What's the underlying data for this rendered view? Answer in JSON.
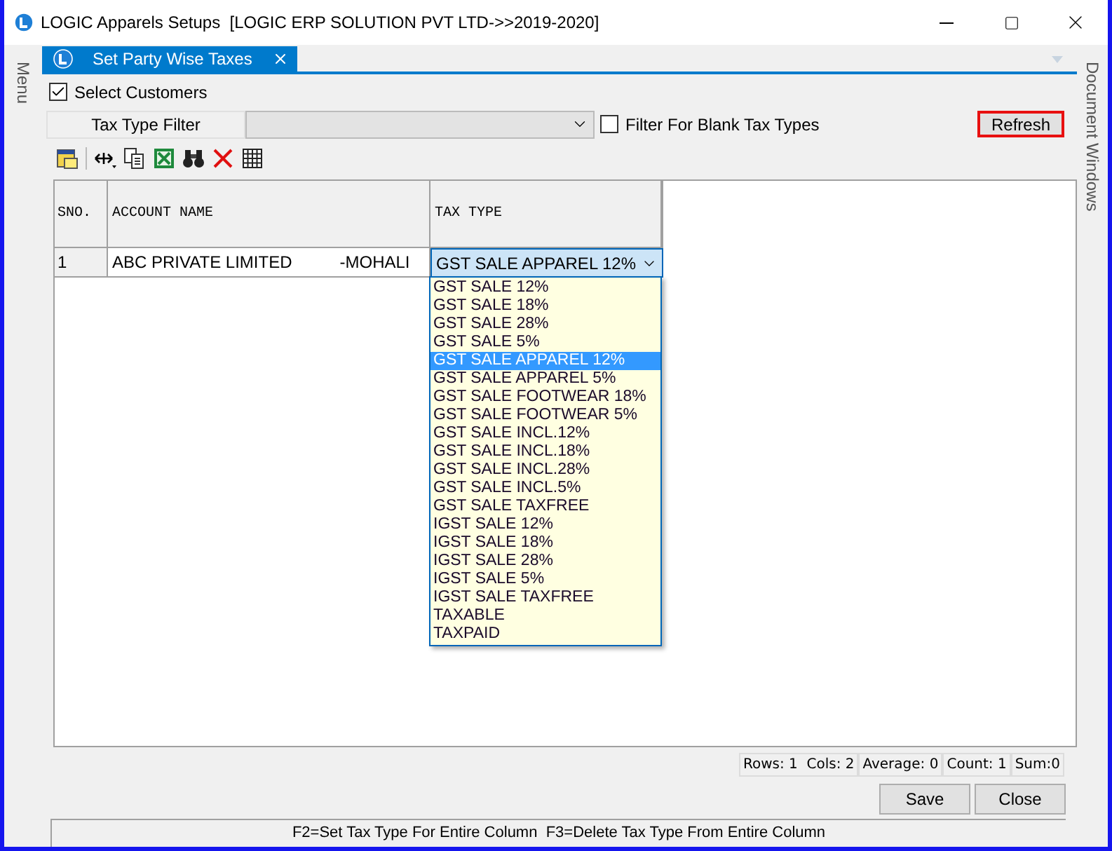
{
  "window": {
    "title": "LOGIC Apparels Setups  [LOGIC ERP SOLUTION PVT LTD->>2019-2020]"
  },
  "side_panels": {
    "left": "Menu",
    "right": "Document Windows"
  },
  "tabs": [
    {
      "label": "Set Party Wise Taxes",
      "selected": true
    }
  ],
  "select_customers": {
    "label": "Select Customers",
    "checked": true
  },
  "filter": {
    "label": "Tax Type Filter",
    "blank_filter": {
      "label": "Filter For Blank Tax Types",
      "checked": false
    }
  },
  "refresh_button": "Refresh",
  "table": {
    "columns": [
      "SNO.",
      "ACCOUNT NAME",
      "TAX TYPE"
    ],
    "rows": [
      {
        "sno": "1",
        "account_name": "ABC PRIVATE LIMITED",
        "location": "-MOHALI",
        "tax_type": "GST SALE APPAREL 12%"
      }
    ]
  },
  "dropdown": {
    "options": [
      {
        "label": "GST SALE 12%",
        "selected": false
      },
      {
        "label": "GST SALE 18%",
        "selected": false
      },
      {
        "label": "GST SALE 28%",
        "selected": false
      },
      {
        "label": "GST SALE 5%",
        "selected": false
      },
      {
        "label": "GST SALE APPAREL 12%",
        "selected": true
      },
      {
        "label": "GST SALE APPAREL 5%",
        "selected": false
      },
      {
        "label": "GST SALE FOOTWEAR 18%",
        "selected": false
      },
      {
        "label": "GST SALE FOOTWEAR 5%",
        "selected": false
      },
      {
        "label": "GST SALE INCL.12%",
        "selected": false
      },
      {
        "label": "GST SALE INCL.18%",
        "selected": false
      },
      {
        "label": "GST SALE INCL.28%",
        "selected": false
      },
      {
        "label": "GST SALE INCL.5%",
        "selected": false
      },
      {
        "label": "GST SALE TAXFREE",
        "selected": false
      },
      {
        "label": "IGST SALE 12%",
        "selected": false
      },
      {
        "label": "IGST SALE 18%",
        "selected": false
      },
      {
        "label": "IGST SALE 28%",
        "selected": false
      },
      {
        "label": "IGST SALE 5%",
        "selected": false
      },
      {
        "label": "IGST SALE TAXFREE",
        "selected": false
      },
      {
        "label": "TAXABLE",
        "selected": false
      },
      {
        "label": "TAXPAID",
        "selected": false
      }
    ]
  },
  "stats": [
    "Rows: 1  Cols: 2",
    "Average: 0",
    "Count: 1",
    "Sum:0"
  ],
  "buttons": [
    "Save",
    "Close"
  ],
  "hint": "F2=Set Tax Type For Entire Column  F3=Delete Tax Type From Entire Column"
}
